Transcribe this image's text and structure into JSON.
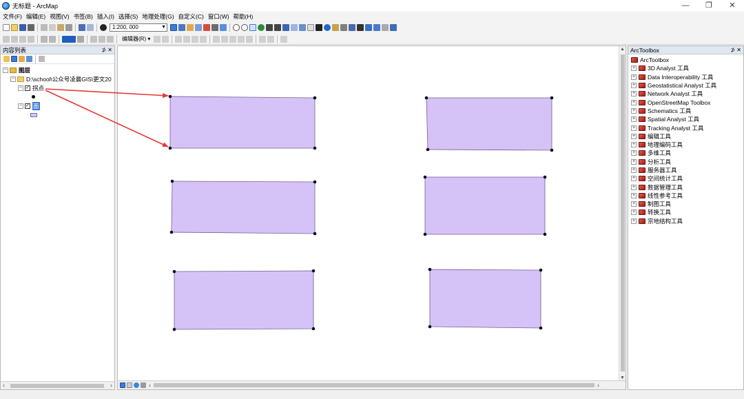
{
  "window": {
    "title": "无标题 - ArcMap",
    "minimize": "—",
    "maximize": "❐",
    "close": "✕"
  },
  "menu": [
    "文件(F)",
    "编辑(E)",
    "视图(V)",
    "书签(B)",
    "插入(I)",
    "选择(S)",
    "地理处理(G)",
    "自定义(C)",
    "窗口(W)",
    "帮助(H)"
  ],
  "toolbar": {
    "scale": "1:200, 000",
    "editor_label": "编辑器(R) ▾"
  },
  "toc": {
    "title": "内容列表",
    "pin": "⊅ ✕",
    "layers_label": "图层",
    "folder_path": "D:\\school\\公众号凌晨GIS\\更文20",
    "layer_point": "拐点",
    "layer_polygon": "面"
  },
  "arctoolbox": {
    "title": "ArcToolbox",
    "pin": "⊅ ✕",
    "root": "ArcToolbox",
    "items": [
      "3D Analyst 工具",
      "Data Interoperability 工具",
      "Geostatistical Analyst 工具",
      "Network Analyst 工具",
      "OpenStreetMap Toolbox",
      "Schematics 工具",
      "Spatial Analyst 工具",
      "Tracking Analyst 工具",
      "编辑工具",
      "地理编码工具",
      "多维工具",
      "分析工具",
      "服务器工具",
      "空间统计工具",
      "数据管理工具",
      "线性参考工具",
      "制图工具",
      "转换工具",
      "宗地结构工具"
    ]
  },
  "colors": {
    "polygon_fill": "#d5c3f7",
    "polygon_stroke": "#6e5f8f",
    "vertex": "#0a0a2a",
    "arrow": "#e53935"
  }
}
